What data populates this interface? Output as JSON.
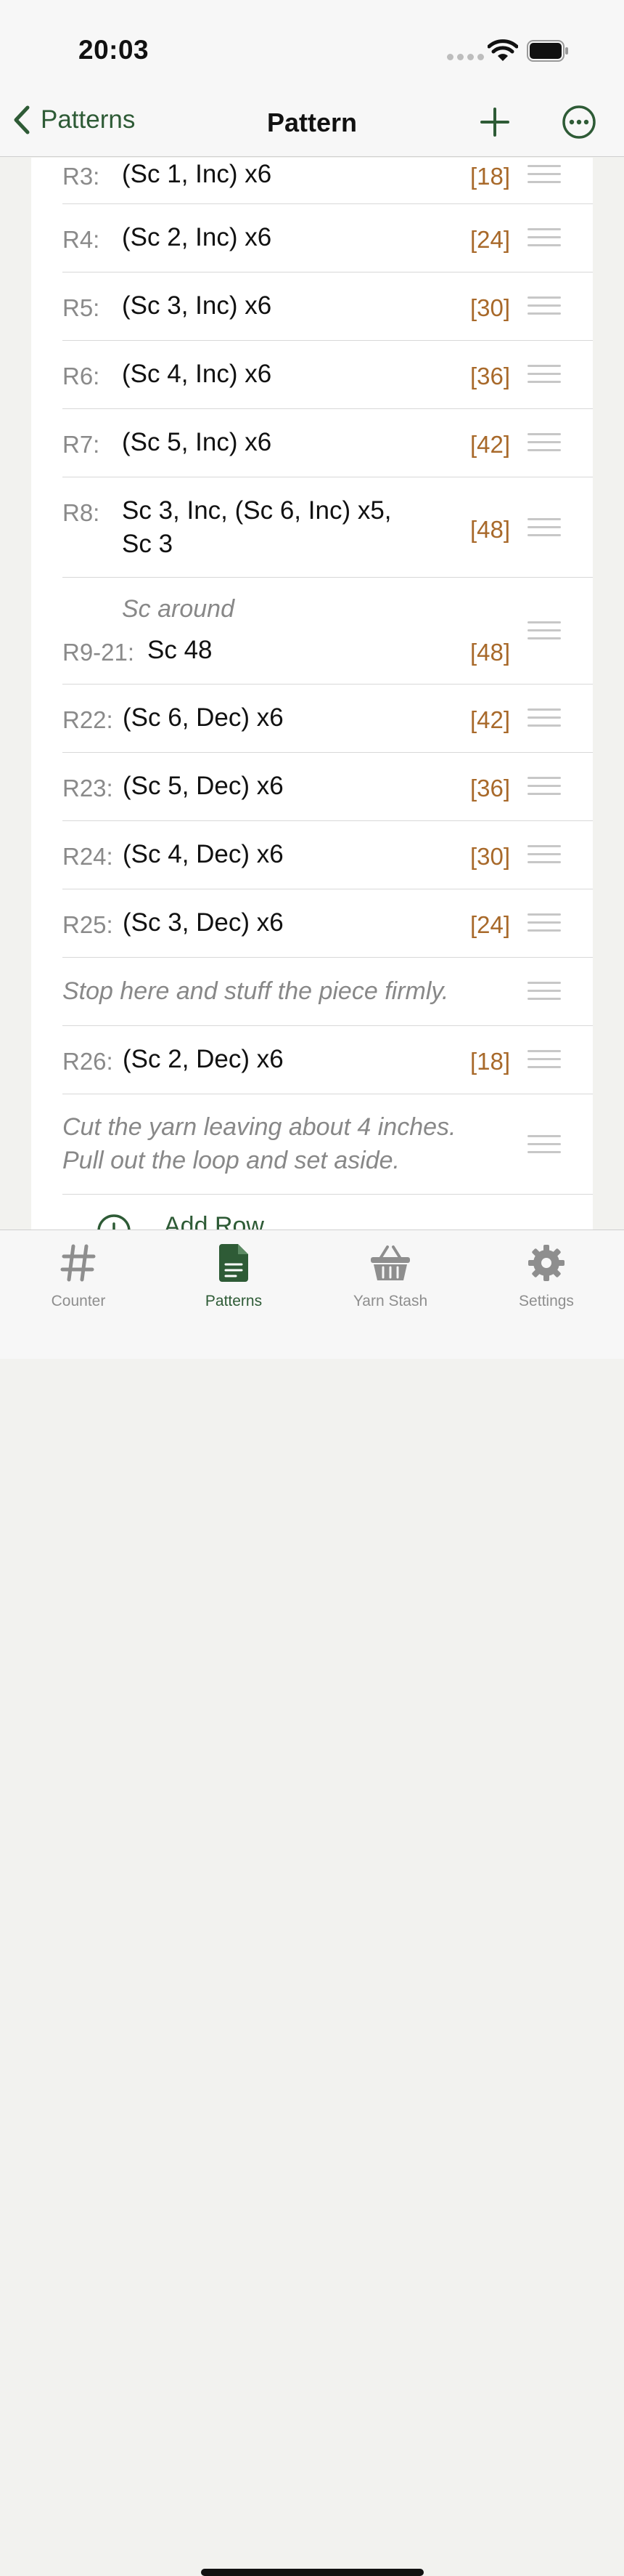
{
  "status": {
    "time": "20:03"
  },
  "nav": {
    "back_label": "Patterns",
    "title": "Pattern"
  },
  "rows": [
    {
      "label": "R3:",
      "text": "(Sc 1, Inc) x6",
      "count": "[18]"
    },
    {
      "label": "R4:",
      "text": "(Sc 2, Inc) x6",
      "count": "[24]"
    },
    {
      "label": "R5:",
      "text": "(Sc 3, Inc) x6",
      "count": "[30]"
    },
    {
      "label": "R6:",
      "text": "(Sc 4, Inc) x6",
      "count": "[36]"
    },
    {
      "label": "R7:",
      "text": "(Sc 5, Inc) x6",
      "count": "[42]"
    },
    {
      "label": "R8:",
      "text_line1": "Sc 3, Inc, (Sc 6, Inc) x5,",
      "text_line2": "Sc 3",
      "count": "[48]"
    },
    {
      "note": "Sc around",
      "label": "R9-21:",
      "text": "Sc 48",
      "count": "[48]"
    },
    {
      "label": "R22:",
      "text": "(Sc 6, Dec) x6",
      "count": "[42]"
    },
    {
      "label": "R23:",
      "text": "(Sc 5, Dec) x6",
      "count": "[36]"
    },
    {
      "label": "R24:",
      "text": "(Sc 4, Dec) x6",
      "count": "[30]"
    },
    {
      "label": "R25:",
      "text": "(Sc 3, Dec) x6",
      "count": "[24]"
    },
    {
      "note": "Stop here and stuff the piece firmly."
    },
    {
      "label": "R26:",
      "text": "(Sc 2, Dec) x6",
      "count": "[18]"
    },
    {
      "note_line1": "Cut the yarn leaving about 4 inches.",
      "note_line2": "Pull out the loop and set aside."
    }
  ],
  "add_row_label": "Add Row",
  "tabs": [
    {
      "label": "Counter",
      "icon": "hash-icon"
    },
    {
      "label": "Patterns",
      "icon": "document-icon",
      "active": true
    },
    {
      "label": "Yarn Stash",
      "icon": "basket-icon"
    },
    {
      "label": "Settings",
      "icon": "gear-icon"
    }
  ],
  "colors": {
    "accent": "#2e5b36",
    "count": "#a8692a"
  }
}
